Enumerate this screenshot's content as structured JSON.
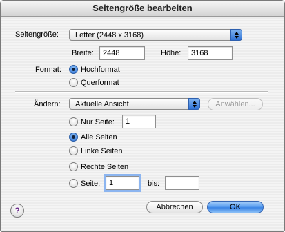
{
  "window": {
    "title": "Seitengröße bearbeiten"
  },
  "page_size": {
    "label": "Seitengröße:",
    "selected": "Letter (2448 x 3168)",
    "width_label": "Breite:",
    "width_value": "2448",
    "height_label": "Höhe:",
    "height_value": "3168"
  },
  "format": {
    "label": "Format:",
    "options": [
      "Hochformat",
      "Querformat"
    ],
    "selected": "Hochformat"
  },
  "change": {
    "label": "Ändern:",
    "selected": "Aktuelle Ansicht",
    "select_button": "Anwählen...",
    "only_page_label": "Nur Seite:",
    "only_page_value": "1",
    "all_pages": "Alle Seiten",
    "left_pages": "Linke Seiten",
    "right_pages": "Rechte Seiten",
    "page_label": "Seite:",
    "page_from": "1",
    "page_to_label": "bis:",
    "page_to": "",
    "selected_option": "Alle Seiten"
  },
  "buttons": {
    "cancel": "Abbrechen",
    "ok": "OK",
    "help": "?"
  }
}
